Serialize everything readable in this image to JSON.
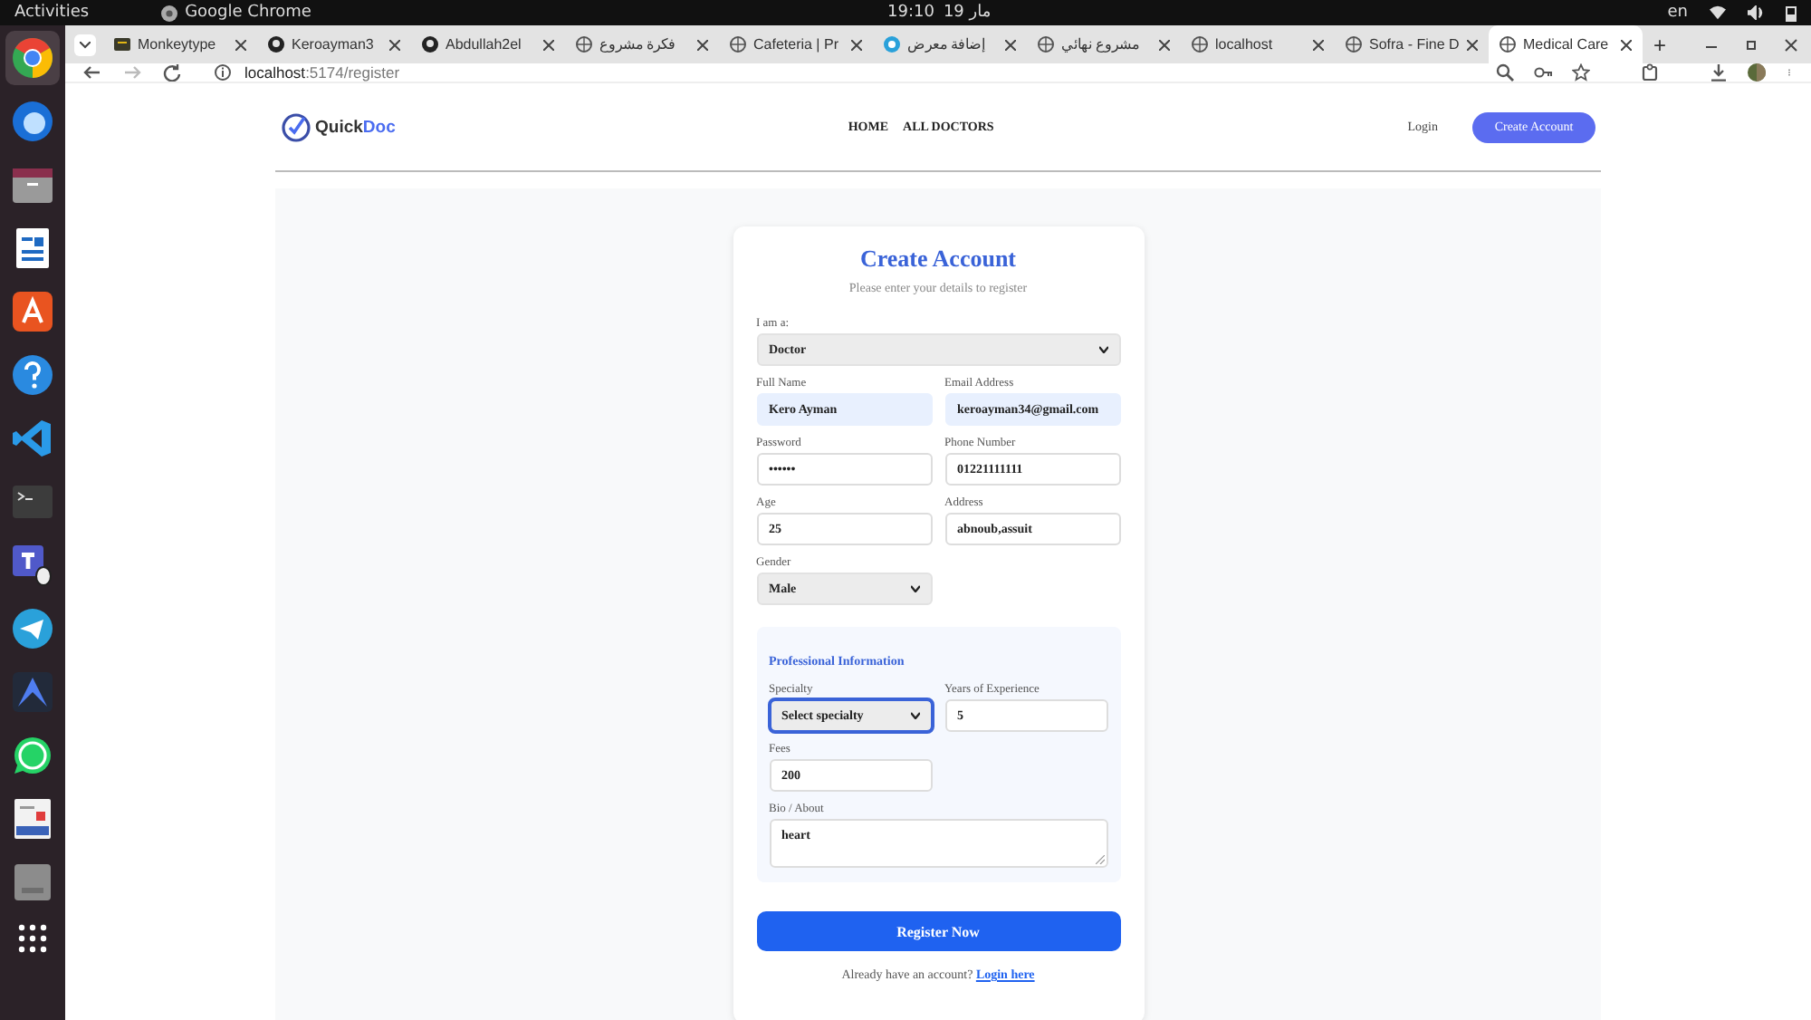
{
  "system_bar": {
    "activities": "Activities",
    "app": "Google Chrome",
    "time": "19:10",
    "date": "19 مار",
    "language": "en"
  },
  "browser": {
    "tabs": [
      {
        "title": "Monkeytype",
        "selected": false
      },
      {
        "title": "Keroayman3",
        "selected": false
      },
      {
        "title": "Abdullah2el",
        "selected": false
      },
      {
        "title": "فكرة مشروع",
        "selected": false
      },
      {
        "title": "Cafeteria | Pr",
        "selected": false
      },
      {
        "title": "إضافة معرض",
        "selected": false
      },
      {
        "title": "مشروع نهائي",
        "selected": false
      },
      {
        "title": "localhost",
        "selected": false
      },
      {
        "title": "Sofra - Fine D",
        "selected": false
      },
      {
        "title": "Medical Care",
        "selected": true
      }
    ],
    "new_tab": "+",
    "address": {
      "host": "localhost",
      "path": ":5174/register"
    }
  },
  "site": {
    "logo": {
      "first": "Quick",
      "second": "Doc"
    },
    "nav": [
      {
        "label": "HOME"
      },
      {
        "label": "ALL DOCTORS"
      }
    ],
    "login": "Login",
    "cta": "Create Account"
  },
  "form": {
    "title": "Create Account",
    "subtitle": "Please enter your details to register",
    "role": {
      "kind": "select",
      "label": "I am a:",
      "value": "Doctor"
    },
    "fields": [
      {
        "kind": "input",
        "label": "Full Name",
        "value": "Kero Ayman",
        "autofilled": true
      },
      {
        "kind": "input",
        "label": "Email Address",
        "value": "keroayman34@gmail.com",
        "autofilled": true
      },
      {
        "kind": "input",
        "label": "Password",
        "value": "••••••",
        "autofilled": false
      },
      {
        "kind": "input",
        "label": "Phone Number",
        "value": "01221111111",
        "autofilled": false
      },
      {
        "kind": "input",
        "label": "Age",
        "value": "25",
        "autofilled": false
      },
      {
        "kind": "input",
        "label": "Address",
        "value": "abnoub,assuit",
        "autofilled": false
      },
      {
        "kind": "select",
        "label": "Gender",
        "value": "Male"
      }
    ],
    "professional": {
      "title": "Professional Information",
      "fields": [
        {
          "kind": "select",
          "label": "Specialty",
          "value": "Select specialty",
          "focused": true
        },
        {
          "kind": "input",
          "label": "Years of Experience",
          "value": "5",
          "focused": false
        },
        {
          "kind": "input",
          "label": "Fees",
          "value": "200",
          "focused": false
        },
        {
          "kind": "textarea",
          "label": "Bio / About",
          "value": "heart",
          "focused": false
        }
      ]
    },
    "submit": "Register Now",
    "footer": {
      "text": "Already have an account?",
      "link": "Login here"
    }
  }
}
